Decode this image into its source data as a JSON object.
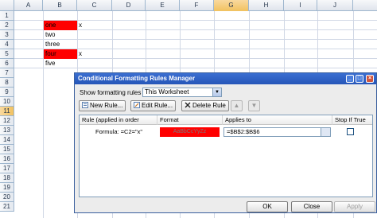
{
  "spreadsheet": {
    "columns": [
      "A",
      "B",
      "C",
      "D",
      "E",
      "F",
      "G",
      "H",
      "I",
      "J"
    ],
    "selected_column": "G",
    "rows": [
      "1",
      "2",
      "3",
      "4",
      "5",
      "6",
      "7",
      "8",
      "9",
      "10",
      "11",
      "12",
      "13",
      "14",
      "15",
      "16",
      "17",
      "18",
      "19",
      "20",
      "21"
    ],
    "selected_row": "11",
    "cells": {
      "b2": "one",
      "c2": "x",
      "b3": "two",
      "b4": "three",
      "b5": "four",
      "c5": "x",
      "b6": "five"
    },
    "highlight_color": "#ff0000"
  },
  "dialog": {
    "title": "Conditional Formatting Rules Manager",
    "show_rules_label": "Show formatting rules for:",
    "show_rules_value": "This Worksheet",
    "new_rule": "New Rule...",
    "edit_rule": "Edit Rule...",
    "delete_rule": "Delete Rule",
    "columns": {
      "rule": "Rule (applied in order shown)",
      "format": "Format",
      "applies_to": "Applies to",
      "stop_if_true": "Stop If True"
    },
    "rules": [
      {
        "condition": "Formula: =C2=\"x\"",
        "format_preview": "AaBbCcYyZz",
        "applies_to": "=$B$2:$B$6",
        "stop_if_true": false
      }
    ],
    "buttons": {
      "ok": "OK",
      "close": "Close",
      "apply": "Apply"
    }
  }
}
